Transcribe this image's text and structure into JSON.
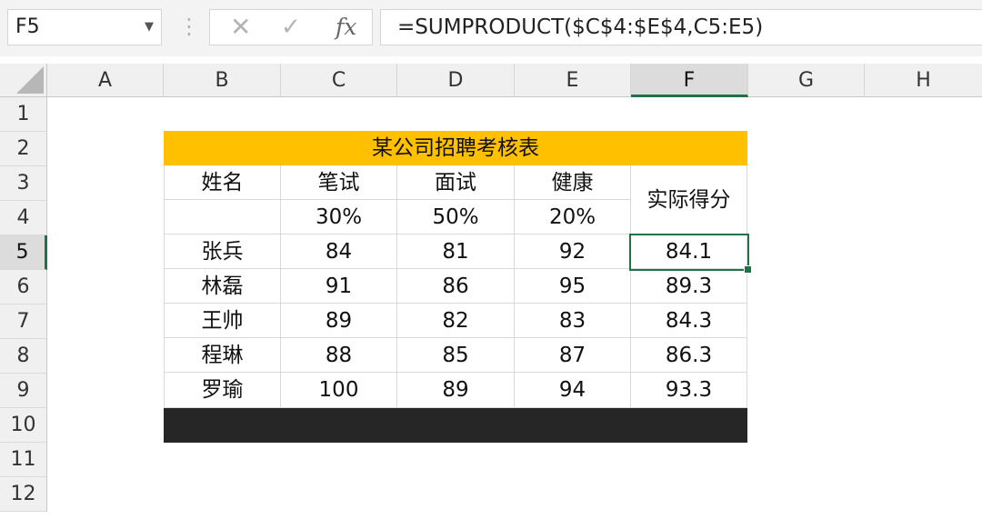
{
  "formula_bar": {
    "name_box": "F5",
    "formula": "=SUMPRODUCT($C$4:$E$4,C5:E5)"
  },
  "icons": {
    "name_box_dropdown": "chevron-down-icon",
    "more": "vertical-dots-icon",
    "cancel": "x-icon",
    "confirm": "check-icon",
    "insert_function": "fx-icon"
  },
  "columns": [
    "A",
    "B",
    "C",
    "D",
    "E",
    "F",
    "G",
    "H"
  ],
  "rows": [
    "1",
    "2",
    "3",
    "4",
    "5",
    "6",
    "7",
    "8",
    "9",
    "10",
    "11",
    "12"
  ],
  "selected": {
    "column": "F",
    "row": "5"
  },
  "colors": {
    "title_fill": "#ffc000",
    "footer_fill": "#262626",
    "selection": "#217346"
  },
  "table": {
    "title": "某公司招聘考核表",
    "headers": {
      "name": "姓名",
      "written": "笔试",
      "interview": "面试",
      "health": "健康",
      "score": "实际得分"
    },
    "weights": {
      "written": "30%",
      "interview": "50%",
      "health": "20%"
    },
    "records": [
      {
        "name": "张兵",
        "written": "84",
        "interview": "81",
        "health": "92",
        "score": "84.1"
      },
      {
        "name": "林磊",
        "written": "91",
        "interview": "86",
        "health": "95",
        "score": "89.3"
      },
      {
        "name": "王帅",
        "written": "89",
        "interview": "82",
        "health": "83",
        "score": "84.3"
      },
      {
        "name": "程琳",
        "written": "88",
        "interview": "85",
        "health": "87",
        "score": "86.3"
      },
      {
        "name": "罗瑜",
        "written": "100",
        "interview": "89",
        "health": "94",
        "score": "93.3"
      }
    ]
  }
}
